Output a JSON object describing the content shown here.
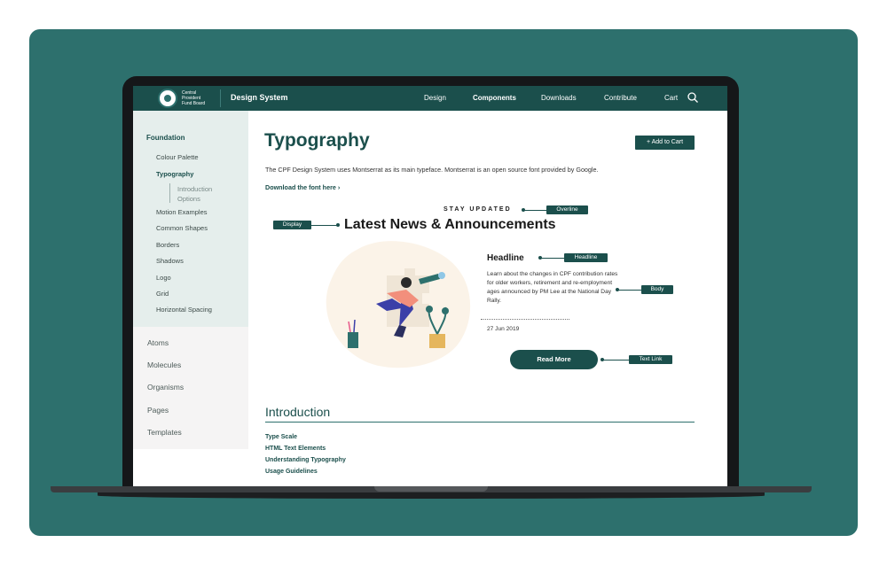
{
  "topnav": {
    "logo_text": [
      "Central",
      "Provident",
      "Fund Board"
    ],
    "brand": "Design System",
    "items": [
      "Design",
      "Components",
      "Downloads",
      "Contribute",
      "Cart"
    ],
    "active_index": 1
  },
  "sidebar": {
    "heading": "Foundation",
    "items": [
      "Colour Palette",
      "Typography",
      "Motion Examples",
      "Common Shapes",
      "Borders",
      "Shadows",
      "Logo",
      "Grid",
      "Horizontal Spacing"
    ],
    "active": "Typography",
    "subitems": [
      "Introduction",
      "Options"
    ],
    "sections": [
      "Atoms",
      "Molecules",
      "Organisms",
      "Pages",
      "Templates"
    ]
  },
  "main": {
    "title": "Typography",
    "cart_button": "+ Add to Cart",
    "intro": "The CPF Design System uses Montserrat as its main typeface. Montserrat is an open source font provided by Google.",
    "download_link": "Download the font here",
    "overline": "STAY UPDATED",
    "display": "Latest News & Announcements",
    "headline": "Headline",
    "body": "Learn about the changes in CPF contribution rates for older workers, retirement and re-employment ages announced by PM Lee at the National Day Rally.",
    "date": "27 Jun 2019",
    "read_more": "Read More",
    "tags": {
      "overline": "Overline",
      "display": "Display",
      "headline": "Headline",
      "body": "Body",
      "text_link": "Text Link"
    },
    "section_title": "Introduction",
    "toc": [
      "Type Scale",
      "HTML Text Elements",
      "Understanding Typography",
      "Usage Guidelines"
    ]
  },
  "colors": {
    "brand": "#1b4f4c",
    "accent": "#2d706d",
    "sidebar_bg": "#e5eeec"
  }
}
